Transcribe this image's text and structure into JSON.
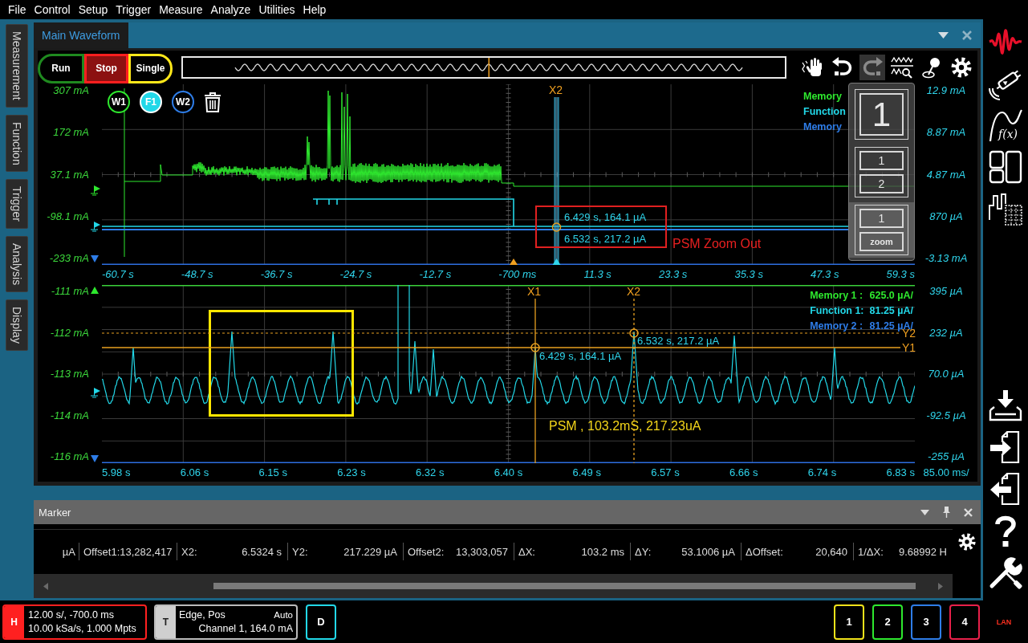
{
  "menu": [
    "File",
    "Control",
    "Setup",
    "Trigger",
    "Measure",
    "Analyze",
    "Utilities",
    "Help"
  ],
  "side_tabs": [
    "Measurement",
    "Function",
    "Trigger",
    "Analysis",
    "Display"
  ],
  "main_window": {
    "title": "Main Waveform"
  },
  "run_controls": [
    {
      "label": "Run",
      "color": "#1f8a1f",
      "selected": false
    },
    {
      "label": "Stop",
      "color": "#ff1f1f",
      "selected": true
    },
    {
      "label": "Single",
      "color": "#ffe81a",
      "selected": false
    }
  ],
  "toolbar": [
    {
      "kind": "gesture",
      "disabled": false
    },
    {
      "kind": "undo",
      "disabled": false
    },
    {
      "kind": "redo",
      "disabled": true
    },
    {
      "kind": "waveform-zoom",
      "disabled": false
    },
    {
      "kind": "joystick",
      "disabled": false
    },
    {
      "kind": "settings",
      "disabled": false
    }
  ],
  "trace_buttons": [
    {
      "label": "W1",
      "color": "#2ee82e",
      "selected": false
    },
    {
      "label": "F1",
      "color": "#22d8e8",
      "selected": true
    },
    {
      "label": "W2",
      "color": "#2e7de8",
      "selected": false
    }
  ],
  "overview_plot": {
    "y_left": [
      "307 mA",
      "172 mA",
      "37.1 mA",
      "-98.1 mA",
      "-233 mA"
    ],
    "y_right": [
      "12.9 mA",
      "8.87 mA",
      "4.87 mA",
      "870 µA",
      "-3.13 mA"
    ],
    "x_ticks": [
      "-60.7 s",
      "-48.7 s",
      "-36.7 s",
      "-24.7 s",
      "-12.7 s",
      "-700 ms",
      "11.3 s",
      "23.3 s",
      "35.3 s",
      "47.3 s",
      "59.3 s"
    ],
    "legend": [
      {
        "name": "Memory",
        "color": "#2ee82e"
      },
      {
        "name": "Function",
        "color": "#22d8e8"
      },
      {
        "name": "Memory",
        "color": "#2e7de8"
      }
    ],
    "cursor_label": "X2",
    "readouts": [
      "6.429 s, 164.1 µA",
      "6.532 s, 217.2 µA"
    ],
    "annotation": "PSM Zoom Out"
  },
  "view_panel": [
    {
      "kind": "single",
      "labels": [
        "1"
      ],
      "selected": false
    },
    {
      "kind": "split",
      "labels": [
        "1",
        "2"
      ],
      "selected": false
    },
    {
      "kind": "zoom",
      "labels": [
        "1",
        "zoom"
      ],
      "selected": true
    }
  ],
  "zoom_plot": {
    "y_left": [
      "-111 mA",
      "-112 mA",
      "-113 mA",
      "-114 mA",
      "-116 mA"
    ],
    "y_right": [
      "395 µA",
      "232 µA",
      "70.0 µA",
      "-92.5 µA",
      "-255 µA"
    ],
    "x_ticks": [
      "5.98 s",
      "6.06 s",
      "6.15 s",
      "6.23 s",
      "6.32 s",
      "6.40 s",
      "6.49 s",
      "6.57 s",
      "6.66 s",
      "6.74 s",
      "6.83 s"
    ],
    "timebase": "85.00 ms/",
    "legend": [
      {
        "name": "Memory 1 :",
        "value": "625.0 µA/",
        "color": "#2ee82e"
      },
      {
        "name": "Function 1:",
        "value": "81.25 µA/",
        "color": "#22d8e8"
      },
      {
        "name": "Memory 2 :",
        "value": "81.25 µA/",
        "color": "#2e7de8"
      }
    ],
    "x_cursors": [
      "X1",
      "X2"
    ],
    "y_cursors": [
      "Y2",
      "Y1"
    ],
    "readouts": [
      "6.429 s, 164.1 µA",
      "6.532 s, 217.2 µA"
    ],
    "annotation": "PSM , 103.2mS, 217.23uA"
  },
  "marker_panel": {
    "title": "Marker",
    "fields": [
      {
        "value": "µA"
      },
      {
        "label": "Offset1:",
        "value": "13,282,417"
      },
      {
        "label": "X2:",
        "value": "6.5324 s"
      },
      {
        "label": "Y2:",
        "value": "217.229 µA"
      },
      {
        "label": "Offset2:",
        "value": "13,303,057"
      },
      {
        "label": "ΔX:",
        "value": "103.2 ms"
      },
      {
        "label": "ΔY:",
        "value": "53.1006 µA"
      },
      {
        "label": "ΔOffset:",
        "value": "20,640"
      },
      {
        "label": "1/ΔX:",
        "value": "9.68992 H"
      }
    ]
  },
  "right_toolbar": {
    "top": [
      {
        "kind": "logo"
      },
      {
        "kind": "probe"
      },
      {
        "kind": "function",
        "label": "f(x)"
      },
      {
        "kind": "layout"
      },
      {
        "kind": "histogram"
      }
    ],
    "bottom": [
      {
        "kind": "save"
      },
      {
        "kind": "import"
      },
      {
        "kind": "export"
      },
      {
        "kind": "help"
      },
      {
        "kind": "tools"
      }
    ]
  },
  "horizontal": {
    "tag": "H",
    "lines": [
      "12.00 s/, -700.0 ms",
      "10.00 kSa/s, 1.000 Mpts"
    ]
  },
  "trigger": {
    "tag": "T",
    "type": "Edge, Pos",
    "mode": "Auto",
    "source": "Channel 1, 164.0 mA"
  },
  "digital": {
    "label": "D"
  },
  "channels": [
    {
      "label": "1",
      "color": "#f0e21a"
    },
    {
      "label": "2",
      "color": "#2ee82e"
    },
    {
      "label": "3",
      "color": "#2e7de8"
    },
    {
      "label": "4",
      "color": "#e8204a"
    }
  ],
  "network": "LAN"
}
